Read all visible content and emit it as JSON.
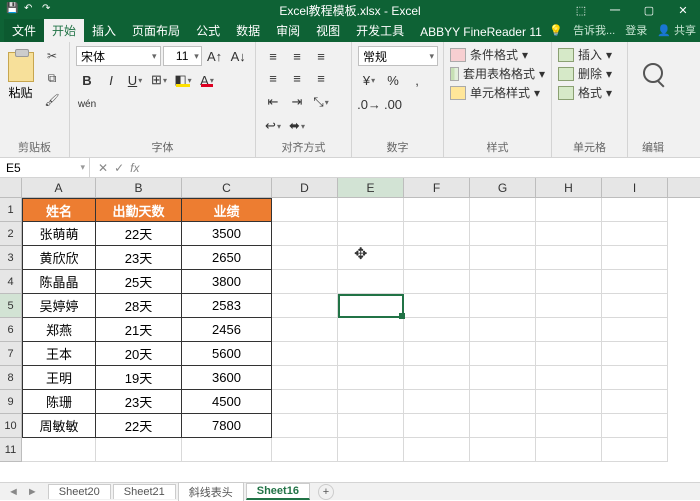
{
  "app": {
    "title": "Excel教程模板.xlsx - Excel"
  },
  "window": {
    "min": "一",
    "restore": "▢",
    "close": "✕",
    "touch": "⬚"
  },
  "tabs": {
    "file": "文件",
    "home": "开始",
    "insert": "插入",
    "layout": "页面布局",
    "formulas": "公式",
    "data": "数据",
    "review": "审阅",
    "view": "视图",
    "developer": "开发工具",
    "abbyy": "ABBYY FineReader 11",
    "tell_me": "告诉我...",
    "signin": "登录",
    "share": "共享"
  },
  "ribbon": {
    "clipboard": {
      "paste": "粘贴",
      "label": "剪贴板"
    },
    "font": {
      "name": "宋体",
      "size": "11",
      "label": "字体"
    },
    "alignment": {
      "label": "对齐方式"
    },
    "number": {
      "format": "常规",
      "label": "数字"
    },
    "styles": {
      "cond": "条件格式",
      "table": "套用表格格式",
      "cell": "单元格样式",
      "label": "样式"
    },
    "cells": {
      "insert": "插入",
      "delete": "删除",
      "format": "格式",
      "label": "单元格"
    },
    "editing": {
      "label": "编辑"
    }
  },
  "namebox": {
    "ref": "E5",
    "fx": "fx"
  },
  "cols": [
    "A",
    "B",
    "C",
    "D",
    "E",
    "F",
    "G",
    "H",
    "I"
  ],
  "rownums": [
    "1",
    "2",
    "3",
    "4",
    "5",
    "6",
    "7",
    "8",
    "9",
    "10",
    "11"
  ],
  "table": {
    "headers": {
      "name": "姓名",
      "days": "出勤天数",
      "perf": "业绩"
    },
    "rows": [
      {
        "name": "张萌萌",
        "days": "22天",
        "perf": "3500"
      },
      {
        "name": "黄欣欣",
        "days": "23天",
        "perf": "2650"
      },
      {
        "name": "陈晶晶",
        "days": "25天",
        "perf": "3800"
      },
      {
        "name": "吴婷婷",
        "days": "28天",
        "perf": "2583"
      },
      {
        "name": "郑燕",
        "days": "21天",
        "perf": "2456"
      },
      {
        "name": "王本",
        "days": "20天",
        "perf": "5600"
      },
      {
        "name": "王明",
        "days": "19天",
        "perf": "3600"
      },
      {
        "name": "陈珊",
        "days": "23天",
        "perf": "4500"
      },
      {
        "name": "周敏敏",
        "days": "22天",
        "perf": "7800"
      }
    ]
  },
  "sheets": {
    "s20": "Sheet20",
    "s21": "Sheet21",
    "sx": "斜线表头",
    "s16": "Sheet16",
    "add": "+"
  }
}
